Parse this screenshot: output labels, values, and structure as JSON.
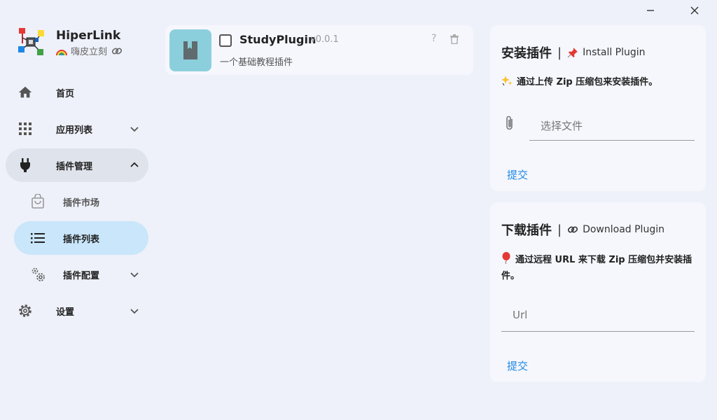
{
  "window": {
    "minimize_label": "minimize",
    "close_label": "close"
  },
  "brand": {
    "title": "HiperLink",
    "subtitle": "嗨皮立刻"
  },
  "sidebar": {
    "items": [
      {
        "label": "首页",
        "icon": "home-icon"
      },
      {
        "label": "应用列表",
        "icon": "apps-grid-icon"
      },
      {
        "label": "插件管理",
        "icon": "plug-icon",
        "expanded": true
      },
      {
        "label": "插件市场",
        "icon": "shopping-bag-icon"
      },
      {
        "label": "插件列表",
        "icon": "list-icon",
        "active": true
      },
      {
        "label": "插件配置",
        "icon": "cogs-icon"
      },
      {
        "label": "设置",
        "icon": "gear-icon"
      }
    ]
  },
  "plugins": [
    {
      "name": "StudyPlugin",
      "version": "v0.0.1",
      "description": "一个基础教程插件",
      "checked": false
    }
  ],
  "install_panel": {
    "title": "安装插件",
    "separator": "|",
    "subtitle": "Install Plugin",
    "note": "通过上传 Zip 压缩包来安装插件。",
    "file_placeholder": "选择文件",
    "submit_label": "提交"
  },
  "download_panel": {
    "title": "下载插件",
    "separator": "|",
    "subtitle": "Download Plugin",
    "note": "通过远程 URL 来下载 Zip 压缩包并安装插件。",
    "url_placeholder": "Url",
    "submit_label": "提交"
  },
  "colors": {
    "background": "#eef1f9",
    "panel": "#f6f7fd",
    "active_nav": "#c9e6fb",
    "expanded_nav": "#dfe3ec",
    "accent": "#1e88e5",
    "plugin_thumb": "#8ccfdc"
  }
}
